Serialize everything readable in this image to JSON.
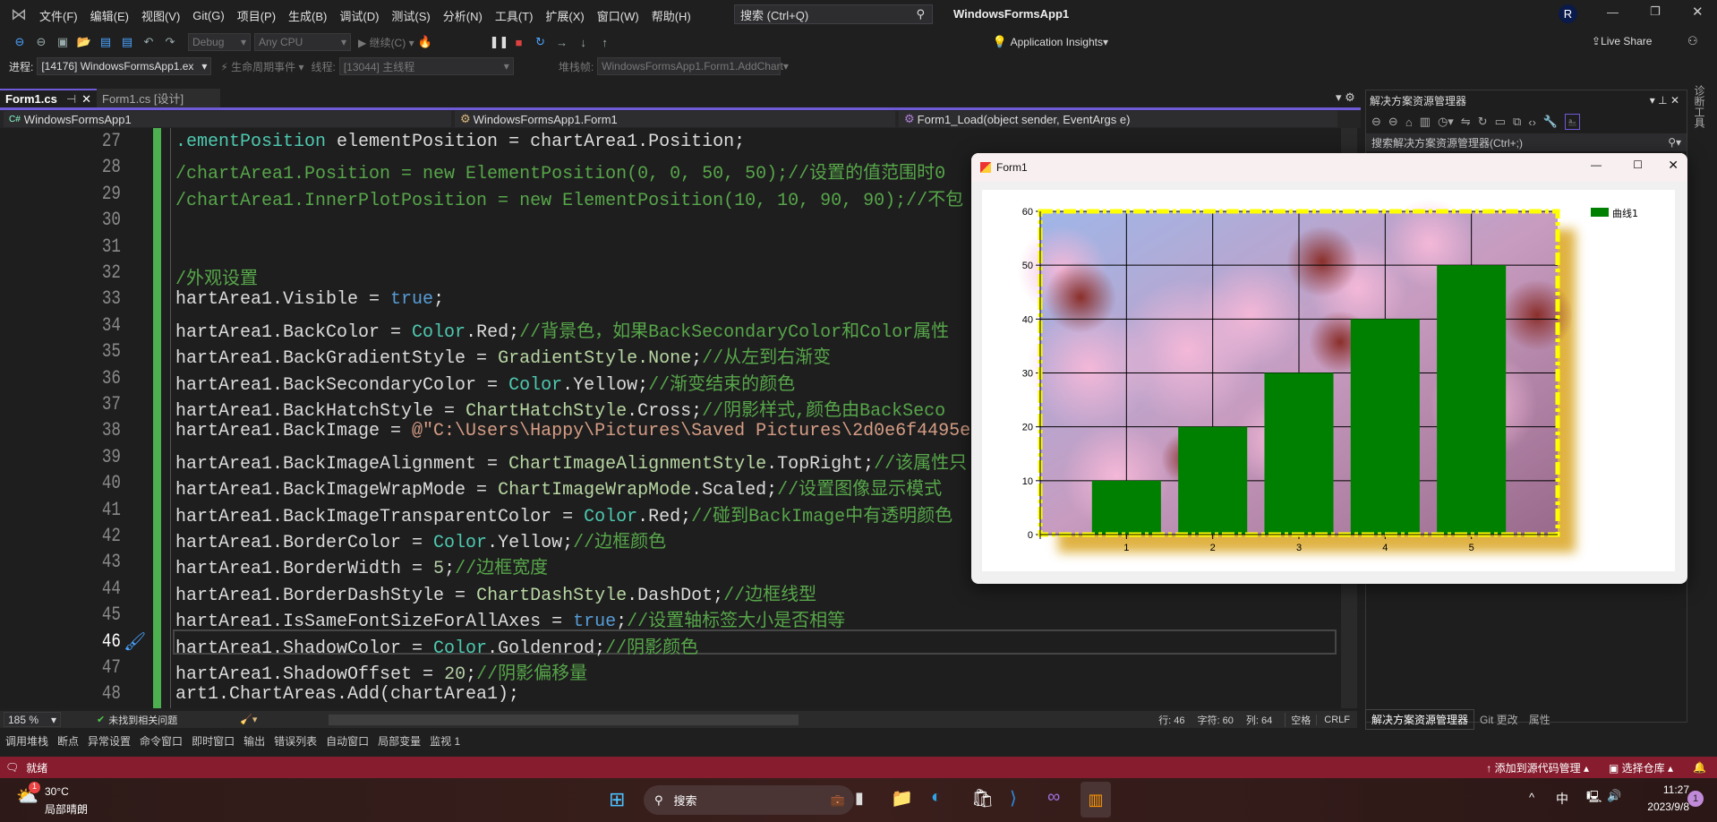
{
  "title": {
    "app_name": "WindowsFormsApp1",
    "account_initial": "R",
    "search_placeholder": "搜索 (Ctrl+Q)"
  },
  "menu": [
    "文件(F)",
    "编辑(E)",
    "视图(V)",
    "Git(G)",
    "项目(P)",
    "生成(B)",
    "调试(D)",
    "测试(S)",
    "分析(N)",
    "工具(T)",
    "扩展(X)",
    "窗口(W)",
    "帮助(H)"
  ],
  "toolbar": {
    "config": "Debug",
    "platform": "Any CPU",
    "continue": "继续(C)",
    "app_insights": "Application Insights",
    "live_share": "Live Share"
  },
  "toolbar2": {
    "process_label": "进程:",
    "process": "[14176] WindowsFormsApp1.ex",
    "lifecycle": "生命周期事件",
    "thread_label": "线程:",
    "thread": "[13044] 主线程",
    "stack_label": "堆栈帧:",
    "stack": "WindowsFormsApp1.Form1.AddChart"
  },
  "tabs": [
    {
      "label": "Form1.cs",
      "active": true
    },
    {
      "label": "Form1.cs [设计]",
      "active": false
    }
  ],
  "navbar": {
    "project": "WindowsFormsApp1",
    "class": "WindowsFormsApp1.Form1",
    "member": "Form1_Load(object sender, EventArgs e)"
  },
  "code": {
    "current_line": 46,
    "lines": [
      {
        "n": "27",
        "tokens": [
          {
            "c": "t",
            "v": ".ementPosition"
          },
          {
            "c": "p",
            "v": " elementPosition = chartArea1.Position;"
          }
        ]
      },
      {
        "n": "28",
        "tokens": [
          {
            "c": "c",
            "v": "/chartArea1.Position = new ElementPosition(0, 0, 50, 50);//设置的值范围时0"
          }
        ]
      },
      {
        "n": "29",
        "tokens": [
          {
            "c": "c",
            "v": "/chartArea1.InnerPlotPosition = new ElementPosition(10, 10, 90, 90);//不包"
          }
        ]
      },
      {
        "n": "30",
        "tokens": []
      },
      {
        "n": "31",
        "tokens": []
      },
      {
        "n": "32",
        "tokens": [
          {
            "c": "c",
            "v": "/外观设置"
          }
        ]
      },
      {
        "n": "33",
        "tokens": [
          {
            "c": "p",
            "v": "hartArea1.Visible = "
          },
          {
            "c": "k",
            "v": "true"
          },
          {
            "c": "p",
            "v": ";"
          }
        ]
      },
      {
        "n": "34",
        "tokens": [
          {
            "c": "p",
            "v": "hartArea1.BackColor = "
          },
          {
            "c": "t",
            "v": "Color"
          },
          {
            "c": "p",
            "v": ".Red;"
          },
          {
            "c": "c",
            "v": "//背景色，如果BackSecondaryColor和Color属性"
          }
        ]
      },
      {
        "n": "35",
        "tokens": [
          {
            "c": "p",
            "v": "hartArea1.BackGradientStyle = "
          },
          {
            "c": "e",
            "v": "GradientStyle.None"
          },
          {
            "c": "p",
            "v": ";"
          },
          {
            "c": "c",
            "v": "//从左到右渐变"
          }
        ]
      },
      {
        "n": "36",
        "tokens": [
          {
            "c": "p",
            "v": "hartArea1.BackSecondaryColor = "
          },
          {
            "c": "t",
            "v": "Color"
          },
          {
            "c": "p",
            "v": ".Yellow;"
          },
          {
            "c": "c",
            "v": "//渐变结束的颜色"
          }
        ]
      },
      {
        "n": "37",
        "tokens": [
          {
            "c": "p",
            "v": "hartArea1.BackHatchStyle = "
          },
          {
            "c": "e",
            "v": "ChartHatchStyle"
          },
          {
            "c": "p",
            "v": ".Cross;"
          },
          {
            "c": "c",
            "v": "//阴影样式,颜色由BackSeco"
          }
        ]
      },
      {
        "n": "38",
        "tokens": [
          {
            "c": "p",
            "v": "hartArea1.BackImage = "
          },
          {
            "c": "s",
            "v": "@\"C:\\Users\\Happy\\Pictures\\Saved Pictures\\2d0e6f4495e"
          }
        ]
      },
      {
        "n": "39",
        "tokens": [
          {
            "c": "p",
            "v": "hartArea1.BackImageAlignment = "
          },
          {
            "c": "e",
            "v": "ChartImageAlignmentStyle"
          },
          {
            "c": "p",
            "v": ".TopRight;"
          },
          {
            "c": "c",
            "v": "//该属性只"
          }
        ]
      },
      {
        "n": "40",
        "tokens": [
          {
            "c": "p",
            "v": "hartArea1.BackImageWrapMode = "
          },
          {
            "c": "e",
            "v": "ChartImageWrapMode"
          },
          {
            "c": "p",
            "v": ".Scaled;"
          },
          {
            "c": "c",
            "v": "//设置图像显示模式"
          }
        ]
      },
      {
        "n": "41",
        "tokens": [
          {
            "c": "p",
            "v": "hartArea1.BackImageTransparentColor = "
          },
          {
            "c": "t",
            "v": "Color"
          },
          {
            "c": "p",
            "v": ".Red;"
          },
          {
            "c": "c",
            "v": "//碰到BackImage中有透明颜色"
          }
        ]
      },
      {
        "n": "42",
        "tokens": [
          {
            "c": "p",
            "v": "hartArea1.BorderColor = "
          },
          {
            "c": "t",
            "v": "Color"
          },
          {
            "c": "p",
            "v": ".Yellow;"
          },
          {
            "c": "c",
            "v": "//边框颜色"
          }
        ]
      },
      {
        "n": "43",
        "tokens": [
          {
            "c": "p",
            "v": "hartArea1.BorderWidth = "
          },
          {
            "c": "n",
            "v": "5"
          },
          {
            "c": "p",
            "v": ";"
          },
          {
            "c": "c",
            "v": "//边框宽度"
          }
        ]
      },
      {
        "n": "44",
        "tokens": [
          {
            "c": "p",
            "v": "hartArea1.BorderDashStyle = "
          },
          {
            "c": "e",
            "v": "ChartDashStyle"
          },
          {
            "c": "p",
            "v": ".DashDot;"
          },
          {
            "c": "c",
            "v": "//边框线型"
          }
        ]
      },
      {
        "n": "45",
        "tokens": [
          {
            "c": "p",
            "v": "hartArea1.IsSameFontSizeForAllAxes = "
          },
          {
            "c": "k",
            "v": "true"
          },
          {
            "c": "p",
            "v": ";"
          },
          {
            "c": "c",
            "v": "//设置轴标签大小是否相等"
          }
        ]
      },
      {
        "n": "46",
        "tokens": [
          {
            "c": "p",
            "v": "hartArea1.ShadowColor = "
          },
          {
            "c": "t",
            "v": "Color"
          },
          {
            "c": "p",
            "v": ".Goldenrod;"
          },
          {
            "c": "c",
            "v": "//阴影颜色"
          }
        ]
      },
      {
        "n": "47",
        "tokens": [
          {
            "c": "p",
            "v": "hartArea1.ShadowOffset = "
          },
          {
            "c": "n",
            "v": "20"
          },
          {
            "c": "p",
            "v": ";"
          },
          {
            "c": "c",
            "v": "//阴影偏移量"
          }
        ]
      },
      {
        "n": "48",
        "tokens": [
          {
            "c": "p",
            "v": "art1.ChartAreas.Add(chartArea1);"
          }
        ]
      }
    ]
  },
  "editor_status": {
    "zoom": "185 %",
    "issues": "未找到相关问题",
    "line": "行: 46",
    "char": "字符: 60",
    "col": "列: 64",
    "whitespace": "空格",
    "eol": "CRLF"
  },
  "solution_explorer": {
    "title": "解决方案资源管理器",
    "search_placeholder": "搜索解决方案资源管理器(Ctrl+;)",
    "bottom_tabs": [
      "解决方案资源管理器",
      "Git 更改",
      "属性"
    ],
    "side_tab": "诊断工具"
  },
  "bottom_tabs": [
    "调用堆栈",
    "断点",
    "异常设置",
    "命令窗口",
    "即时窗口",
    "输出",
    "错误列表",
    "自动窗口",
    "局部变量",
    "监视 1"
  ],
  "statusbar": {
    "ready": "就绪",
    "add_source": "添加到源代码管理",
    "select_repo": "选择仓库",
    "color": "#871c2e"
  },
  "taskbar": {
    "temp": "30°C",
    "weather": "局部晴朗",
    "weather_badge": "1",
    "search": "搜索",
    "ime": "中",
    "time": "11:27",
    "date": "2023/9/8",
    "notif": "1"
  },
  "form": {
    "title": "Form1"
  },
  "chart_data": {
    "type": "bar",
    "categories": [
      "1",
      "2",
      "3",
      "4",
      "5"
    ],
    "series": [
      {
        "name": "曲线1",
        "values": [
          10,
          20,
          30,
          40,
          50
        ],
        "color": "#008000"
      }
    ],
    "ylim": [
      0,
      60
    ],
    "xlim": [
      0,
      6
    ],
    "yticks": [
      0,
      10,
      20,
      30,
      40,
      50,
      60
    ],
    "grid": true,
    "legend": "top-right",
    "border_color": "#ffff00",
    "border_style": "dashdot",
    "shadow_color": "#daa520",
    "background": "cherry blossom photo"
  }
}
